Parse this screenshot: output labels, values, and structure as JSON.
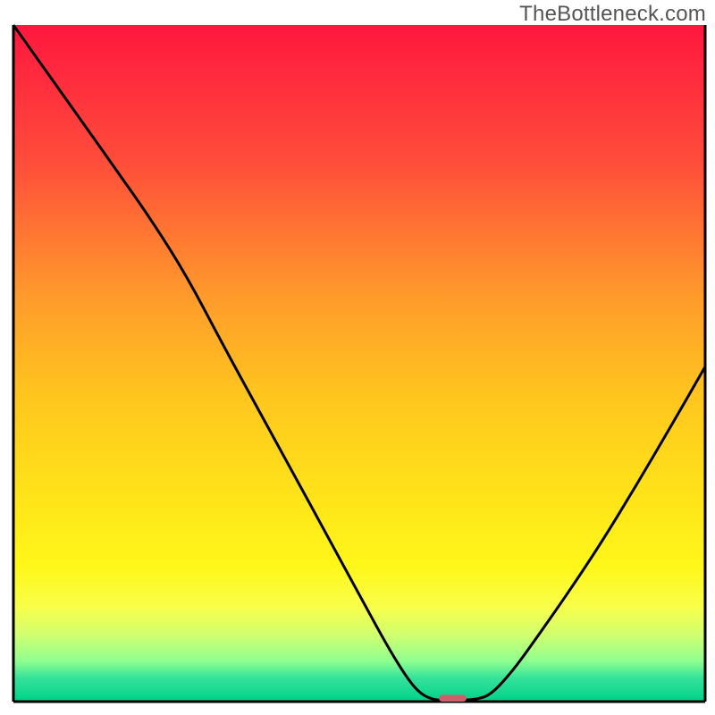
{
  "watermark": "TheBottleneck.com",
  "chart_data": {
    "type": "line",
    "title": "",
    "xlabel": "",
    "ylabel": "",
    "xlim": [
      0,
      100
    ],
    "ylim": [
      0,
      100
    ],
    "grid": false,
    "legend": "none",
    "background": {
      "gradient_stops": [
        {
          "offset": 0.0,
          "color": "#ff173f"
        },
        {
          "offset": 0.2,
          "color": "#ff4c3a"
        },
        {
          "offset": 0.4,
          "color": "#ff9a2b"
        },
        {
          "offset": 0.55,
          "color": "#ffc61e"
        },
        {
          "offset": 0.7,
          "color": "#ffe419"
        },
        {
          "offset": 0.8,
          "color": "#fff71a"
        },
        {
          "offset": 0.86,
          "color": "#f8ff4a"
        },
        {
          "offset": 0.9,
          "color": "#d2ff6e"
        },
        {
          "offset": 0.94,
          "color": "#8fff8f"
        },
        {
          "offset": 0.965,
          "color": "#36e29a"
        },
        {
          "offset": 1.0,
          "color": "#00d18a"
        }
      ]
    },
    "series": [
      {
        "name": "bottleneck-curve",
        "color": "#000000",
        "points": [
          {
            "x": 0.0,
            "y": 100.0
          },
          {
            "x": 5.0,
            "y": 92.8
          },
          {
            "x": 10.0,
            "y": 85.6
          },
          {
            "x": 15.0,
            "y": 78.4
          },
          {
            "x": 20.0,
            "y": 71.1
          },
          {
            "x": 25.0,
            "y": 63.0
          },
          {
            "x": 30.0,
            "y": 53.3
          },
          {
            "x": 35.0,
            "y": 43.9
          },
          {
            "x": 40.0,
            "y": 34.6
          },
          {
            "x": 45.0,
            "y": 25.2
          },
          {
            "x": 50.0,
            "y": 15.8
          },
          {
            "x": 54.0,
            "y": 8.3
          },
          {
            "x": 57.0,
            "y": 3.3
          },
          {
            "x": 59.0,
            "y": 1.0
          },
          {
            "x": 61.0,
            "y": 0.2
          },
          {
            "x": 63.0,
            "y": 0.2
          },
          {
            "x": 65.0,
            "y": 0.2
          },
          {
            "x": 67.0,
            "y": 0.35
          },
          {
            "x": 69.0,
            "y": 1.0
          },
          {
            "x": 72.0,
            "y": 4.3
          },
          {
            "x": 75.0,
            "y": 8.5
          },
          {
            "x": 80.0,
            "y": 15.8
          },
          {
            "x": 85.0,
            "y": 23.5
          },
          {
            "x": 90.0,
            "y": 31.9
          },
          {
            "x": 95.0,
            "y": 40.6
          },
          {
            "x": 100.0,
            "y": 49.5
          }
        ]
      }
    ],
    "marker": {
      "name": "optimal-point",
      "x": 63.5,
      "y": 0.0,
      "width": 4.0,
      "height": 1.0,
      "rx": 0.6,
      "color": "#cc5f6a"
    },
    "axes": {
      "show": true,
      "color": "#000000",
      "width": 3
    }
  }
}
